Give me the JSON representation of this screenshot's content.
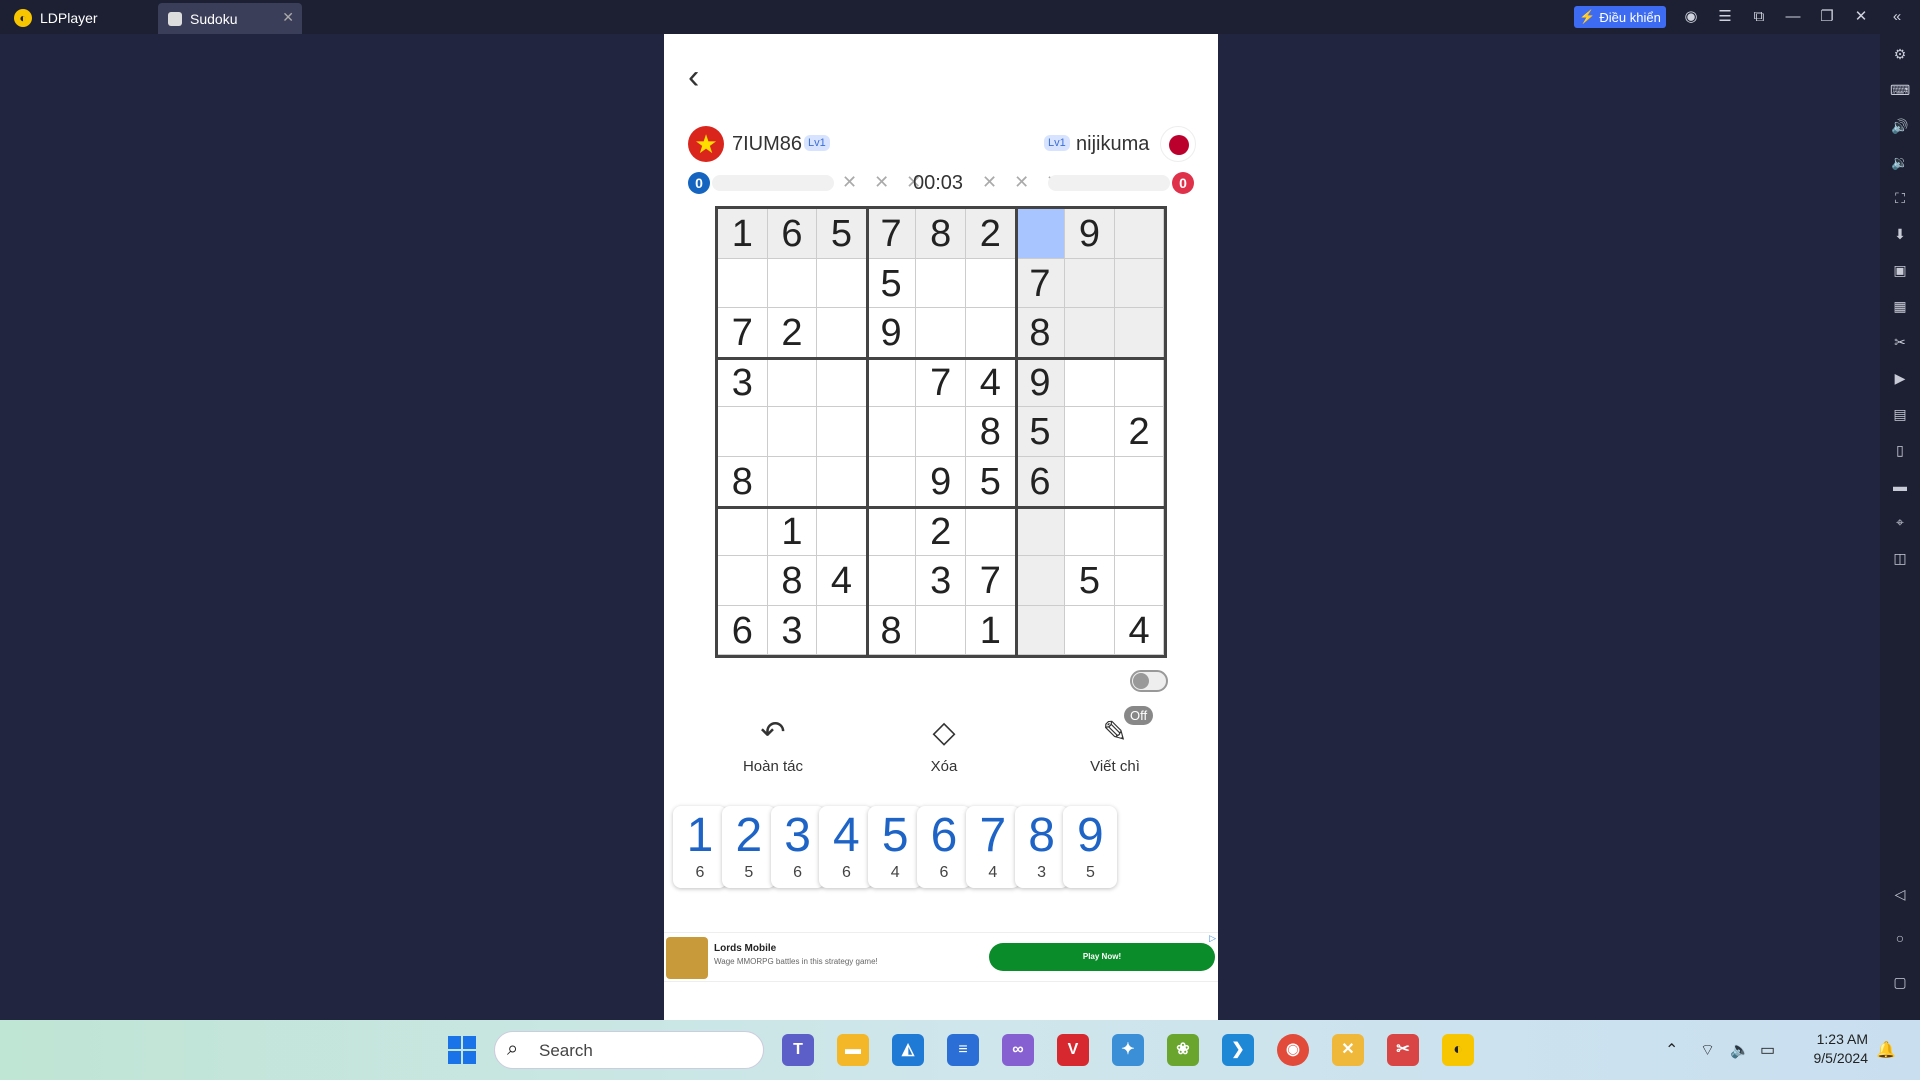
{
  "window": {
    "app_name": "LDPlayer",
    "tab_title": "Sudoku",
    "control_button": "Điều khiển"
  },
  "game": {
    "player1": {
      "name": "7IUM86",
      "level": "Lv1",
      "score": "0"
    },
    "player2": {
      "name": "nijikuma",
      "level": "Lv1",
      "score": "0"
    },
    "timer": "00:03",
    "mistakes_left": "✕ ✕ ✕",
    "mistakes_right": "✕ ✕ ✕",
    "grid": [
      [
        "1",
        "6",
        "5",
        "7",
        "8",
        "2",
        "",
        "9",
        ""
      ],
      [
        "",
        "",
        "",
        "5",
        "",
        "",
        "7",
        "",
        ""
      ],
      [
        "7",
        "2",
        "",
        "9",
        "",
        "",
        "8",
        "",
        ""
      ],
      [
        "3",
        "",
        "",
        "",
        "7",
        "4",
        "9",
        "",
        ""
      ],
      [
        "",
        "",
        "",
        "",
        "",
        "8",
        "5",
        "",
        "2"
      ],
      [
        "8",
        "",
        "",
        "",
        "9",
        "5",
        "6",
        "",
        ""
      ],
      [
        "",
        "1",
        "",
        "",
        "2",
        "",
        "",
        "",
        ""
      ],
      [
        "",
        "8",
        "4",
        "",
        "3",
        "7",
        "",
        "5",
        ""
      ],
      [
        "6",
        "3",
        "",
        "8",
        "",
        "1",
        "",
        "",
        "4"
      ]
    ],
    "selected_cell": {
      "row": 0,
      "col": 6
    },
    "tools": {
      "undo": "Hoàn tác",
      "erase": "Xóa",
      "pencil": "Viết chì",
      "pencil_state": "Off"
    },
    "numpad": [
      {
        "n": "1",
        "c": "6"
      },
      {
        "n": "2",
        "c": "5"
      },
      {
        "n": "3",
        "c": "6"
      },
      {
        "n": "4",
        "c": "6"
      },
      {
        "n": "5",
        "c": "4"
      },
      {
        "n": "6",
        "c": "6"
      },
      {
        "n": "7",
        "c": "4"
      },
      {
        "n": "8",
        "c": "3"
      },
      {
        "n": "9",
        "c": "5"
      }
    ],
    "ad": {
      "title": "Lords Mobile",
      "description": "Wage MMORPG battles in this strategy game!",
      "cta": "Play Now!"
    }
  },
  "taskbar": {
    "search_placeholder": "Search",
    "time": "1:23 AM",
    "date": "9/5/2024"
  },
  "colors": {
    "selected": "#a9c5ff",
    "highlight": "#eeeeee",
    "accent": "#1e63c6",
    "p1": "#1565c0",
    "p2": "#e0314b"
  }
}
